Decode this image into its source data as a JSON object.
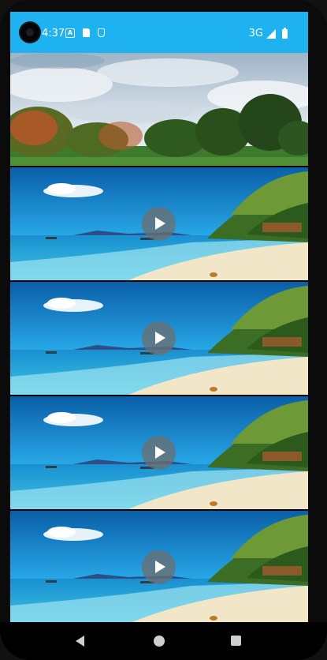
{
  "status_bar": {
    "time": "4:37",
    "network": "3G",
    "icons": [
      "font-a-icon",
      "sd-card-icon",
      "usb-icon",
      "signal-icon",
      "battery-icon"
    ],
    "background": "#1eb3f0"
  },
  "feed": {
    "header_image": "landscape-trees-sky",
    "videos": [
      {
        "thumbnail": "tropical-beach-palm",
        "control": "play-icon"
      },
      {
        "thumbnail": "tropical-beach-palm",
        "control": "play-icon"
      },
      {
        "thumbnail": "tropical-beach-palm",
        "control": "play-icon"
      },
      {
        "thumbnail": "tropical-beach-palm",
        "control": "play-icon"
      }
    ]
  },
  "nav": {
    "buttons": [
      "back-icon",
      "home-icon",
      "recents-icon"
    ]
  }
}
